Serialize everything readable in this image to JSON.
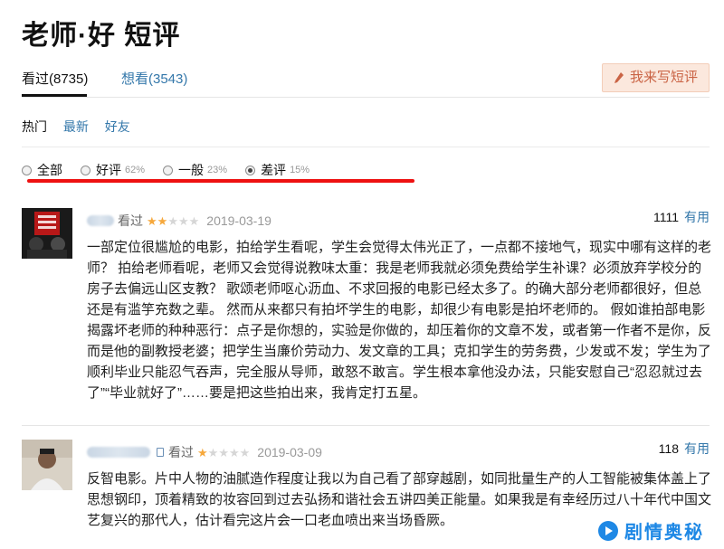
{
  "page": {
    "title": "老师·好 短评"
  },
  "tabs": {
    "watched": "看过(8735)",
    "want": "想看(3543)",
    "write_button": "我来写短评"
  },
  "sort": {
    "hot": "热门",
    "latest": "最新",
    "friends": "好友"
  },
  "filters": {
    "all": {
      "label": "全部"
    },
    "good": {
      "label": "好评",
      "pct": "62%"
    },
    "average": {
      "label": "一般",
      "pct": "23%"
    },
    "bad": {
      "label": "差评",
      "pct": "15%",
      "selected": true
    }
  },
  "comments": [
    {
      "status": "看过",
      "rating": 2,
      "date": "2019-03-19",
      "votes": "1111",
      "useful_label": "有用",
      "text": "一部定位很尴尬的电影，拍给学生看呢，学生会觉得太伟光正了，一点都不接地气，现实中哪有这样的老师？ 拍给老师看呢，老师又会觉得说教味太重：我是老师我就必须免费给学生补课？必须放弃学校分的房子去偏远山区支教？ 歌颂老师呕心沥血、不求回报的电影已经太多了。的确大部分老师都很好，但总还是有滥竽充数之辈。 然而从来都只有拍坏学生的电影，却很少有电影是拍坏老师的。 假如谁拍部电影揭露坏老师的种种恶行：点子是你想的，实验是你做的，却压着你的文章不发，或者第一作者不是你，反而是他的副教授老婆；把学生当廉价劳动力、发文章的工具；克扣学生的劳务费，少发或不发；学生为了顺利毕业只能忍气吞声，完全服从导师，敢怒不敢言。学生根本拿他没办法，只能安慰自己“忍忍就过去了”“毕业就好了”……要是把这些拍出来，我肯定打五星。"
    },
    {
      "status": "看过",
      "rating": 1,
      "date": "2019-03-09",
      "votes": "118",
      "useful_label": "有用",
      "text": "反智电影。片中人物的油腻造作程度让我以为自己看了部穿越剧，如同批量生产的人工智能被集体盖上了思想钢印，顶着精致的妆容回到过去弘扬和谐社会五讲四美正能量。如果我是有幸经历过八十年代中国文艺复兴的那代人，估计看完这片会一口老血喷出来当场昏厥。"
    }
  ],
  "watermark": {
    "text": "剧情奥秘"
  },
  "colors": {
    "link": "#3377aa",
    "accent_btn": "#ca6445",
    "star": "#f6a83c",
    "highlight": "#ee1111"
  }
}
